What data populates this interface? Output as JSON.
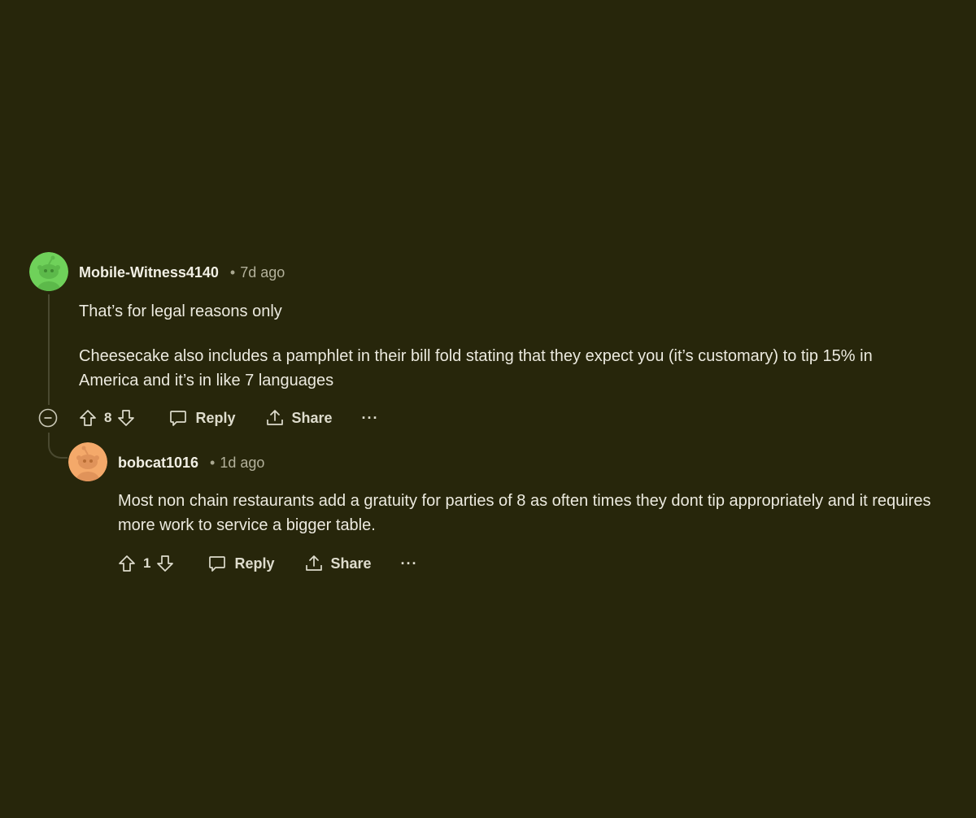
{
  "colors": {
    "background": "#27260b",
    "thread_line": "#4a4930",
    "avatar_green": "#6fd15a",
    "avatar_orange": "#f4a96a"
  },
  "comments": [
    {
      "username": "Mobile-Witness4140",
      "separator": "•",
      "time": "7d ago",
      "paragraphs": [
        "That’s for legal reasons only",
        "Cheesecake also includes a pamphlet in their bill fold stating that they expect you (it’s customary) to tip 15% in America and it’s in like 7 languages"
      ],
      "votes": "8",
      "reply_label": "Reply",
      "share_label": "Share",
      "more_label": "···",
      "avatar_icon": "snoo-avatar-icon"
    },
    {
      "username": "bobcat1016",
      "separator": "•",
      "time": "1d ago",
      "paragraphs": [
        "Most non chain restaurants add a gratuity for parties of 8 as often times they dont tip appropriately and it requires more work to service a bigger table."
      ],
      "votes": "1",
      "reply_label": "Reply",
      "share_label": "Share",
      "more_label": "···",
      "avatar_icon": "snoo-avatar-icon"
    }
  ]
}
